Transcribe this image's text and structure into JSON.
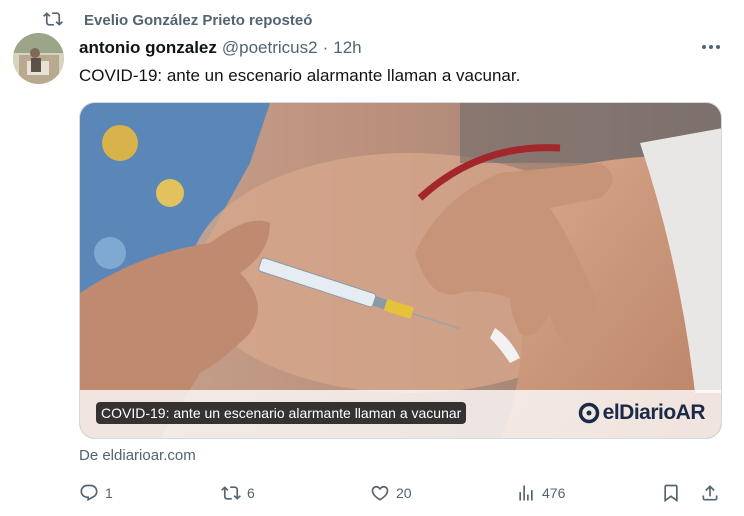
{
  "repost": {
    "text": "Evelio González Prieto reposteó",
    "icon": "repost-icon"
  },
  "post": {
    "author_name": "antonio gonzalez",
    "author_handle": "@poetricus2",
    "separator": "·",
    "time": "12h",
    "text": "COVID-19: ante un escenario alarmante llaman a vacunar.",
    "card": {
      "caption": "COVID-19: ante un escenario alarmante llaman a vacunar",
      "logo_text": "elDiarioAR"
    },
    "source": "De eldiarioar.com"
  },
  "actions": {
    "replies": "1",
    "reposts": "6",
    "likes": "20",
    "views": "476"
  },
  "colors": {
    "secondary": "#536471",
    "text": "#0f1419",
    "logo": "#1a2a47"
  }
}
